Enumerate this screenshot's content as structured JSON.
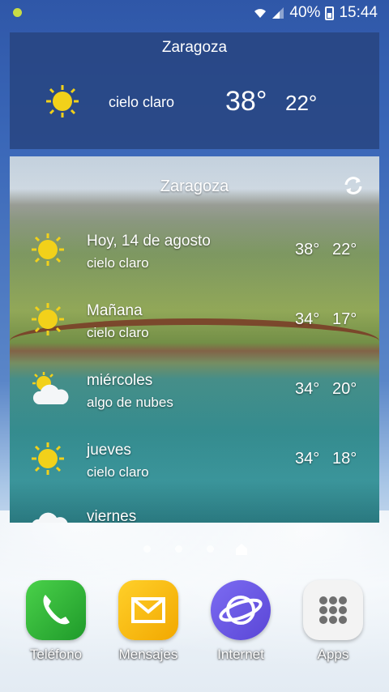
{
  "status_bar": {
    "battery": "40%",
    "time": "15:44"
  },
  "weather_widget": {
    "city": "Zaragoza",
    "icon": "sun-icon",
    "condition": "cielo claro",
    "high": "38°",
    "low": "22°"
  },
  "forecast_widget": {
    "city": "Zaragoza",
    "days": [
      {
        "day": "Hoy, 14 de agosto",
        "condition": "cielo claro",
        "icon": "sun-icon",
        "high": "38°",
        "low": "22°"
      },
      {
        "day": "Mañana",
        "condition": "cielo claro",
        "icon": "sun-icon",
        "high": "34°",
        "low": "17°"
      },
      {
        "day": "miércoles",
        "condition": "algo de nubes",
        "icon": "partly-cloudy-icon",
        "high": "34°",
        "low": "20°"
      },
      {
        "day": "jueves",
        "condition": "cielo claro",
        "icon": "sun-icon",
        "high": "34°",
        "low": "18°"
      },
      {
        "day": "viernes",
        "condition": "",
        "icon": "cloud-icon",
        "high": "",
        "low": ""
      }
    ]
  },
  "pager": {
    "page_count": 4,
    "current_home": true
  },
  "dock": {
    "apps": [
      {
        "label": "Teléfono",
        "icon": "phone-icon",
        "color": "#2eb82e"
      },
      {
        "label": "Mensajes",
        "icon": "envelope-icon",
        "color": "#f5b800"
      },
      {
        "label": "Internet",
        "icon": "internet-icon",
        "color": "#6a5be0"
      },
      {
        "label": "Apps",
        "icon": "apps-grid-icon",
        "color": "#f2f2f2"
      }
    ]
  }
}
